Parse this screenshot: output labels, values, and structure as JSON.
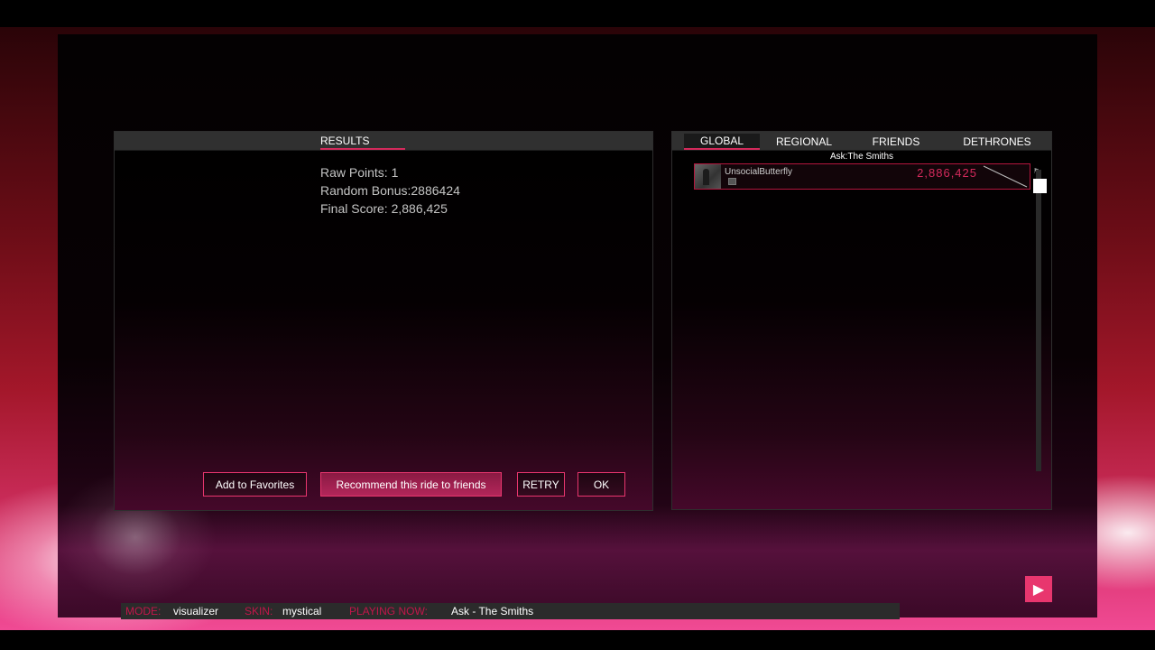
{
  "results": {
    "title": "RESULTS",
    "raw_points": "Raw Points: 1",
    "random_bonus": "Random Bonus:2886424",
    "final_score": "Final Score: 2,886,425",
    "buttons": {
      "favorites": "Add to Favorites",
      "recommend": "Recommend this ride to friends",
      "retry": "RETRY",
      "ok": "OK"
    }
  },
  "leaderboard": {
    "tabs": [
      "GLOBAL",
      "REGIONAL",
      "FRIENDS",
      "DETHRONES"
    ],
    "active_tab": "GLOBAL",
    "song": "Ask:The Smiths",
    "entries": [
      {
        "username": "UnsocialButterfly",
        "score": "2,886,425"
      }
    ]
  },
  "status_bar": {
    "mode_label": "MODE:",
    "mode_value": "visualizer",
    "skin_label": "SKIN:",
    "skin_value": "mystical",
    "playing_label": "PLAYING NOW:",
    "playing_value": "Ask - The Smiths"
  },
  "icons": {
    "play": "play-icon",
    "flag": "flag-icon",
    "avatar": "avatar-icon"
  },
  "colors": {
    "accent": "#e8366e",
    "score": "#d42a5c",
    "label": "#c2164a"
  }
}
